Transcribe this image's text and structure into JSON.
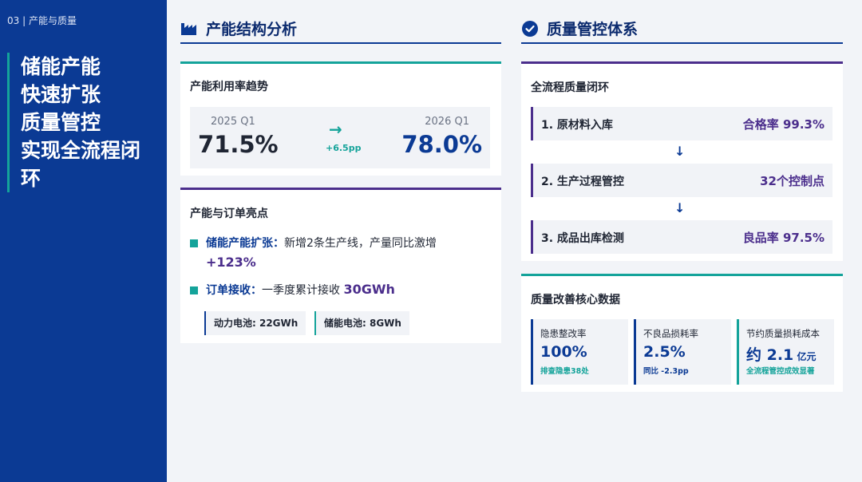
{
  "breadcrumb": "03 | 产能与质量",
  "hero_lines": [
    "储能产能",
    "快速扩张",
    "质量管控",
    "实现全流程闭",
    "环"
  ],
  "capacity_section": {
    "title": "产能结构分析",
    "icon": "factory-icon",
    "utilization": {
      "title": "产能利用率趋势",
      "from_label": "2025 Q1",
      "from_value": "71.5%",
      "arrow": "→",
      "delta": "+6.5pp",
      "to_label": "2026 Q1",
      "to_value": "78.0%"
    },
    "highlights": {
      "title": "产能与订单亮点",
      "item1_key": "储能产能扩张：",
      "item1_text": "新增2条生产线，产量同比激增",
      "item1_value": "+123%",
      "item2_key": "订单接收：",
      "item2_text": "一季度累计接收 ",
      "item2_value": "30GWh",
      "chip1": "动力电池: 22GWh",
      "chip2": "储能电池: 8GWh"
    }
  },
  "quality_section": {
    "title": "质量管控体系",
    "icon": "check-circle-icon",
    "loop": {
      "title": "全流程质量闭环",
      "steps": [
        {
          "name": "1. 原材料入库",
          "value": "合格率 99.3%"
        },
        {
          "name": "2. 生产过程管控",
          "value": "32个控制点"
        },
        {
          "name": "3. 成品出库检测",
          "value": "良品率 97.5%"
        }
      ],
      "down_arrow": "↓"
    },
    "metrics": {
      "title": "质量改善核心数据",
      "items": [
        {
          "label": "隐患整改率",
          "value": "100%",
          "unit": "",
          "sub": "排查隐患38处"
        },
        {
          "label": "不良品损耗率",
          "value": "2.5%",
          "unit": "",
          "sub": "同比 -2.3pp"
        },
        {
          "label": "节约质量损耗成本",
          "value": "约 2.1",
          "unit": " 亿元",
          "sub": "全流程管控成效显著"
        }
      ]
    }
  },
  "colors": {
    "navy": "#0b3a94",
    "teal": "#14a39a",
    "purple": "#4b2e8c",
    "background": "#f2f4f8"
  }
}
